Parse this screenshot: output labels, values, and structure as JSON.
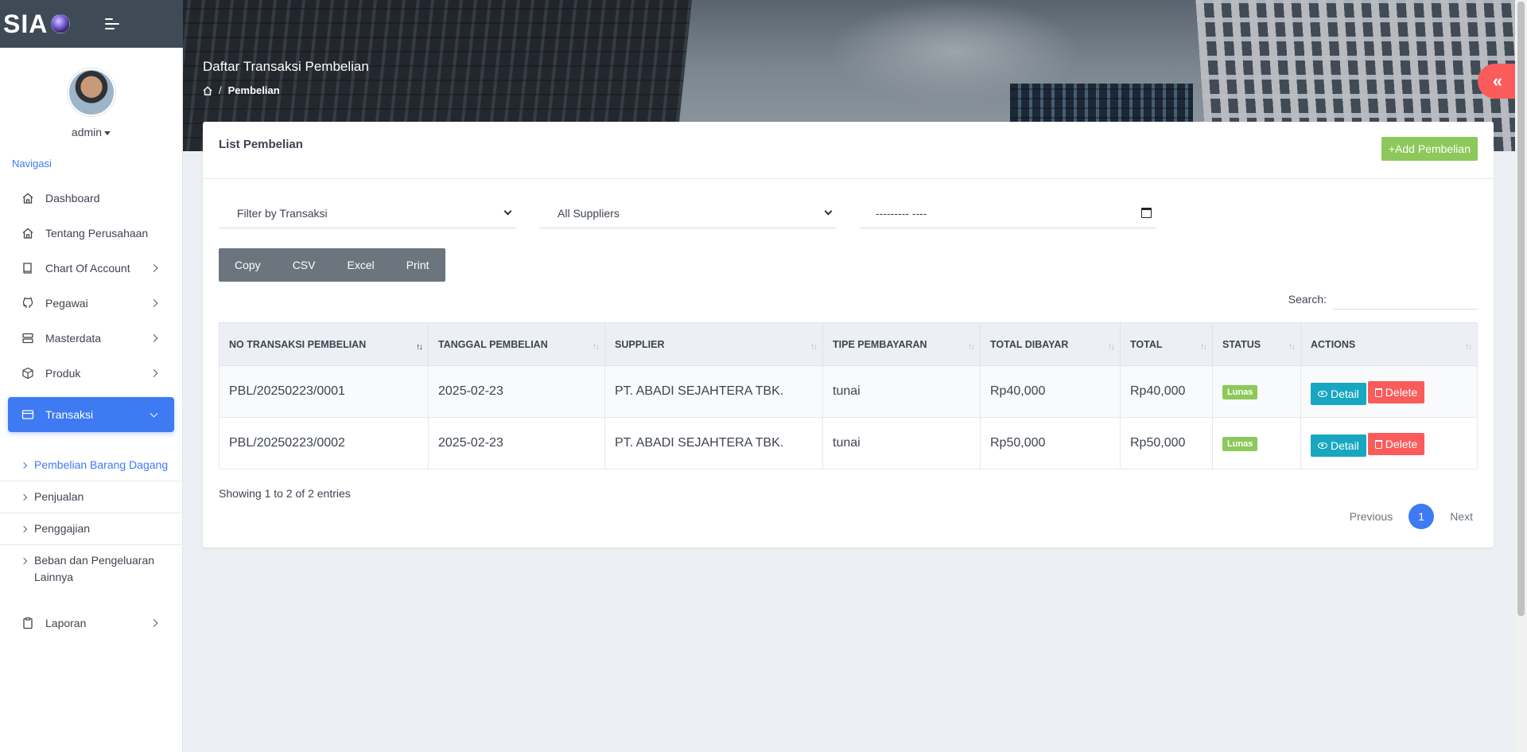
{
  "app": {
    "logo": "SIA"
  },
  "header": {
    "title": "Daftar Transaksi Pembelian",
    "breadcrumb_current": "Pembelian"
  },
  "user": {
    "name": "admin"
  },
  "sidebar": {
    "nav_label": "Navigasi",
    "items": [
      {
        "label": "Dashboard",
        "icon": "home-icon",
        "has_children": false
      },
      {
        "label": "Tentang Perusahaan",
        "icon": "home-icon",
        "has_children": false
      },
      {
        "label": "Chart Of Account",
        "icon": "book-icon",
        "has_children": true
      },
      {
        "label": "Pegawai",
        "icon": "github-icon",
        "has_children": true
      },
      {
        "label": "Masterdata",
        "icon": "server-icon",
        "has_children": true
      },
      {
        "label": "Produk",
        "icon": "box-icon",
        "has_children": true
      },
      {
        "label": "Transaksi",
        "icon": "credit-card-icon",
        "has_children": true,
        "active": true
      }
    ],
    "sub_items": [
      {
        "label": "Pembelian Barang Dagang",
        "current": true
      },
      {
        "label": "Penjualan"
      },
      {
        "label": "Penggajian"
      },
      {
        "label": "Beban dan Pengeluaran Lainnya"
      }
    ],
    "after_items": [
      {
        "label": "Laporan",
        "icon": "clipboard-icon",
        "has_children": true
      }
    ]
  },
  "card": {
    "title": "List Pembelian",
    "add_button": "+Add Pembelian",
    "filters": {
      "transaksi": "Filter by Transaksi",
      "supplier": "All Suppliers",
      "date": "--------- ----"
    },
    "export_buttons": [
      "Copy",
      "CSV",
      "Excel",
      "Print"
    ],
    "search_label": "Search:",
    "table": {
      "headers": [
        "NO TRANSAKSI PEMBELIAN",
        "TANGGAL PEMBELIAN",
        "SUPPLIER",
        "TIPE PEMBAYARAN",
        "TOTAL DIBAYAR",
        "TOTAL",
        "STATUS",
        "ACTIONS"
      ],
      "rows": [
        {
          "no": "PBL/20250223/0001",
          "tanggal": "2025-02-23",
          "supplier": "PT. ABADI SEJAHTERA TBK.",
          "tipe": "tunai",
          "dibayar": "Rp40,000",
          "total": "Rp40,000",
          "status": "Lunas"
        },
        {
          "no": "PBL/20250223/0002",
          "tanggal": "2025-02-23",
          "supplier": "PT. ABADI SEJAHTERA TBK.",
          "tipe": "tunai",
          "dibayar": "Rp50,000",
          "total": "Rp50,000",
          "status": "Lunas"
        }
      ],
      "detail_label": "Detail",
      "delete_label": "Delete"
    },
    "info": "Showing 1 to 2 of 2 entries",
    "pagination": {
      "previous": "Previous",
      "current": "1",
      "next": "Next"
    }
  },
  "colors": {
    "accent": "#3e7af2",
    "success": "#8dc85a",
    "info": "#18a7c0",
    "danger": "#fa5b5b"
  }
}
